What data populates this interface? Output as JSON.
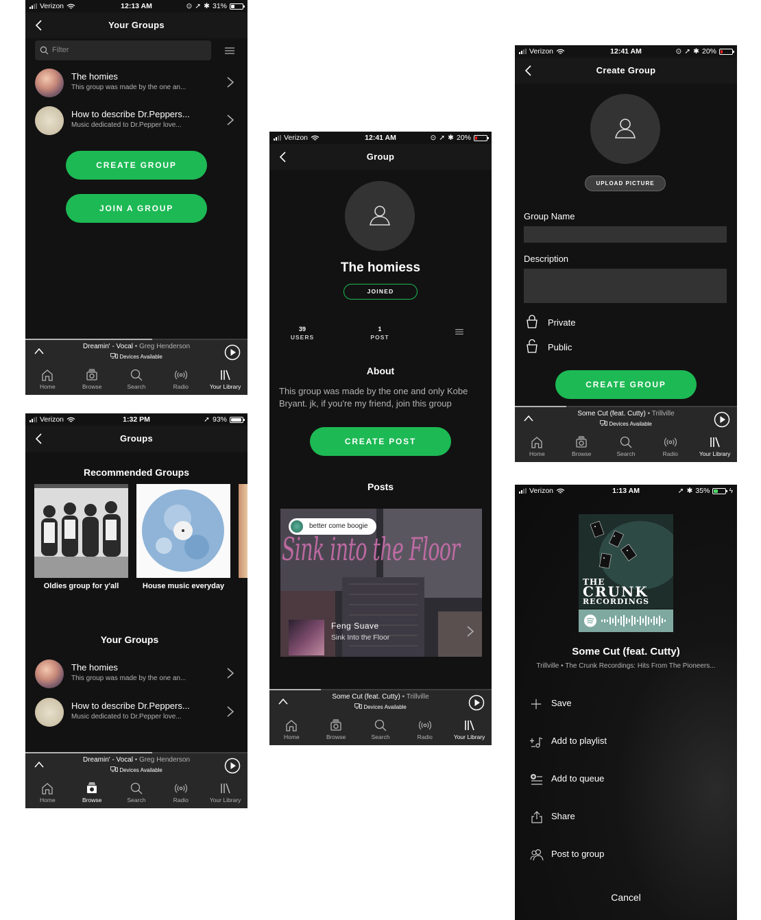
{
  "colors": {
    "bg": "#121212",
    "bar": "#181818",
    "player": "#282828",
    "accent": "#1db954",
    "muted": "#b3b3b3"
  },
  "tab_labels": {
    "home": "Home",
    "browse": "Browse",
    "search": "Search",
    "radio": "Radio",
    "library": "Your Library"
  },
  "screen1": {
    "status": {
      "carrier": "Verizon",
      "time": "12:13 AM",
      "battery": "31%",
      "battery_level": 0.31
    },
    "title": "Your Groups",
    "filter_placeholder": "Filter",
    "groups": [
      {
        "name": "The homies",
        "desc": "This group was made by the one an..."
      },
      {
        "name": "How to describe Dr.Peppers...",
        "desc": "Music dedicated to Dr.Pepper love..."
      }
    ],
    "create_button": "CREATE GROUP",
    "join_button": "JOIN A GROUP",
    "player": {
      "song": "Dreamin' - Vocal",
      "sep": " • ",
      "artist": "Greg Henderson",
      "devices": "Devices Available",
      "progress": 0.57
    },
    "active_tab": "library"
  },
  "screen2": {
    "status": {
      "carrier": "Verizon",
      "time": "1:32 PM",
      "battery": "93%",
      "battery_level": 0.93
    },
    "title": "Groups",
    "recommended_heading": "Recommended Groups",
    "recommended": [
      {
        "caption": "Oldies group for y'all"
      },
      {
        "caption": "House music everyday"
      }
    ],
    "your_groups_heading": "Your Groups",
    "groups": [
      {
        "name": "The homies",
        "desc": "This group was made by the one an..."
      },
      {
        "name": "How to describe Dr.Peppers...",
        "desc": "Music dedicated to Dr.Pepper love..."
      }
    ],
    "player": {
      "song": "Dreamin' - Vocal",
      "sep": " • ",
      "artist": "Greg Henderson",
      "devices": "Devices Available",
      "progress": 0.57
    },
    "active_tab": "browse"
  },
  "screen3": {
    "status": {
      "carrier": "Verizon",
      "time": "12:41 AM",
      "battery": "20%",
      "battery_level": 0.2
    },
    "title": "Group",
    "group_name": "The homiess",
    "joined_badge": "JOINED",
    "users_count": "39",
    "users_label": "USERS",
    "posts_count": "1",
    "posts_label": "POST",
    "about_heading": "About",
    "about_text": "This group was made by the one and only Kobe Bryant. jk, if you're my friend, join this group",
    "create_post_button": "CREATE POST",
    "posts_heading": "Posts",
    "post": {
      "comment": "better come boogie",
      "art_text": "Sink into the Floor",
      "artist": "Feng Suave",
      "track": "Sink Into the Floor"
    },
    "player": {
      "song": "Some Cut (feat. Cutty)",
      "sep": " • ",
      "artist": "Trillville",
      "devices": "Devices Available",
      "progress": 0.23
    },
    "active_tab": "library"
  },
  "screen4": {
    "status": {
      "carrier": "Verizon",
      "time": "12:41 AM",
      "battery": "20%",
      "battery_level": 0.2
    },
    "title": "Create Group",
    "upload_button": "UPLOAD PICTURE",
    "group_name_label": "Group Name",
    "description_label": "Description",
    "private_label": "Private",
    "public_label": "Public",
    "create_button": "CREATE GROUP",
    "player": {
      "song": "Some Cut (feat. Cutty)",
      "sep": " • ",
      "artist": "Trillville",
      "devices": "Devices Available",
      "progress": 0.23
    },
    "active_tab": "library"
  },
  "screen5": {
    "status": {
      "carrier": "Verizon",
      "time": "1:13 AM",
      "battery": "35%",
      "battery_level": 0.35
    },
    "album_text_line1": "THE",
    "album_text_line2": "CRUNK",
    "album_text_line3": "RECORDINGS",
    "song_title": "Some Cut (feat. Cutty)",
    "song_subtitle": "Trillville • The Crunk Recordings: Hits From The Pioneers...",
    "menu": [
      {
        "label": "Save",
        "icon": "plus-icon"
      },
      {
        "label": "Add to playlist",
        "icon": "add-to-playlist-icon"
      },
      {
        "label": "Add to queue",
        "icon": "add-to-queue-icon"
      },
      {
        "label": "Share",
        "icon": "share-icon"
      },
      {
        "label": "Post to group",
        "icon": "post-to-group-icon"
      }
    ],
    "cancel": "Cancel"
  }
}
